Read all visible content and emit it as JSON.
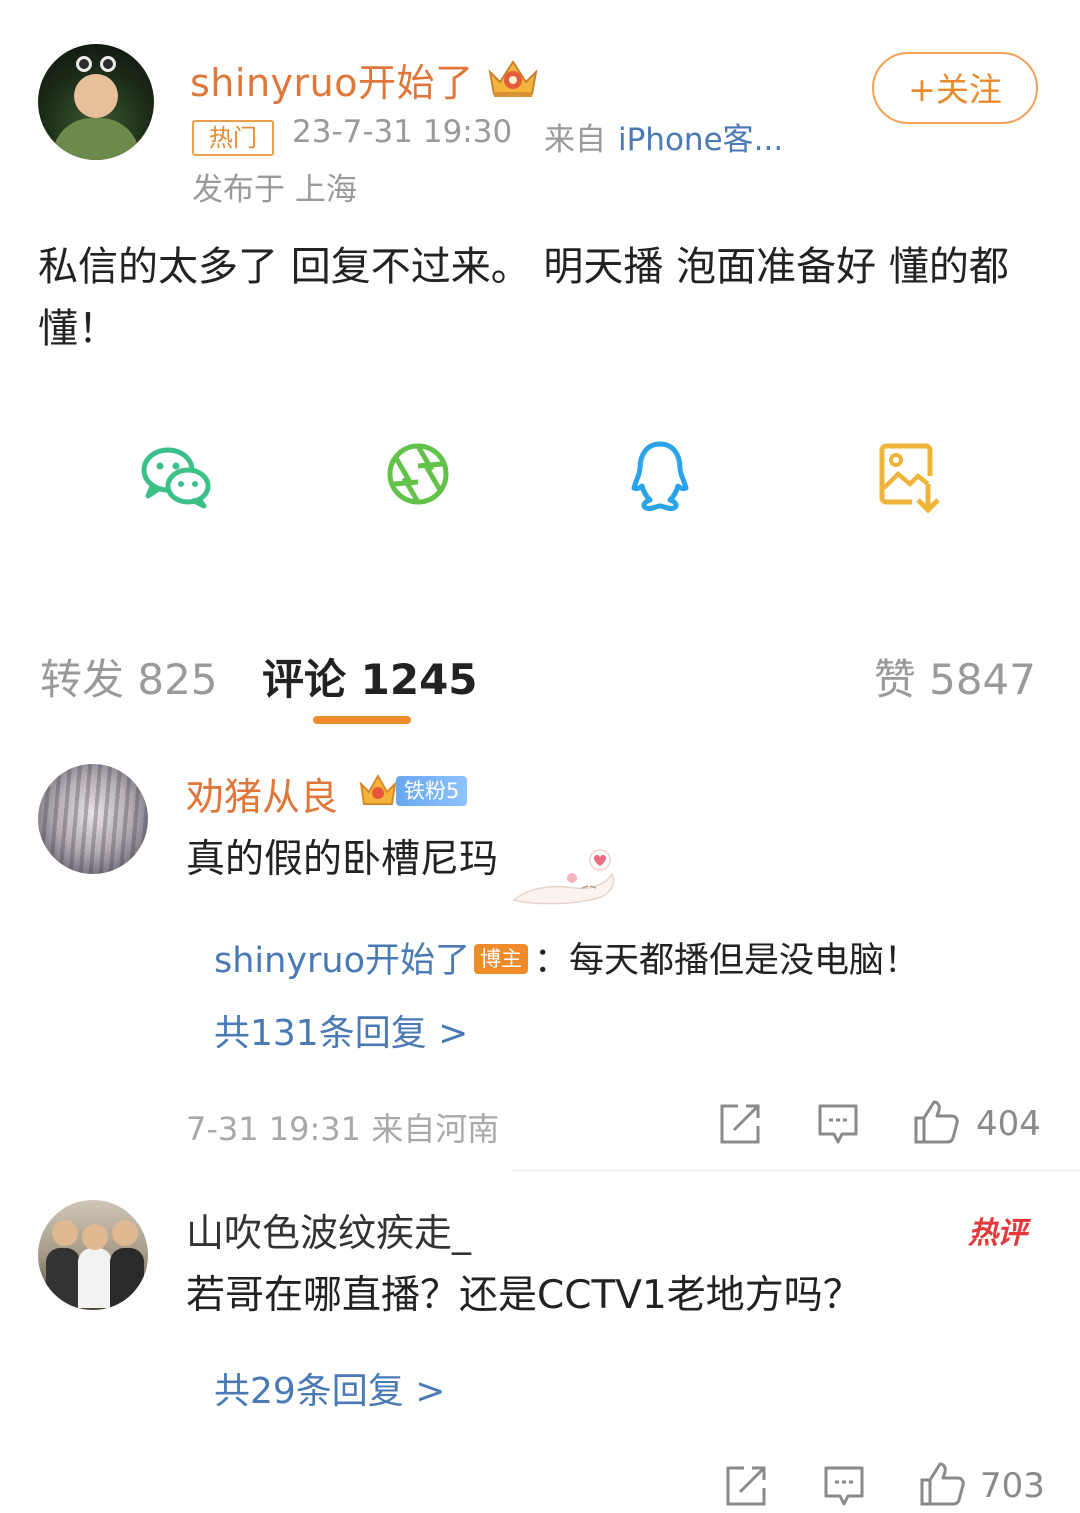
{
  "post": {
    "author": "shinyruo开始了",
    "hot_badge": "热门",
    "time": "23-7-31 19:30",
    "from_label": "来自",
    "client": "iPhone客...",
    "location": "发布于 上海",
    "follow_label": "+关注",
    "text": "私信的太多了 回复不过来。 明天播 泡面准备好 懂的都懂！",
    "share_icons": [
      "wechat-icon",
      "moments-icon",
      "qq-icon",
      "save-image-icon"
    ]
  },
  "stats": {
    "repost": "转发 825",
    "comment": "评论 1245",
    "like": "赞 5847"
  },
  "comments": [
    {
      "author": "劝猪从良",
      "fan_badge": "铁粉5",
      "text": "真的假的卧槽尼玛",
      "reply": {
        "author": "shinyruo开始了",
        "tag": "博主",
        "text": "：每天都播但是没电脑！"
      },
      "reply_count": "共131条回复 >",
      "meta": "7-31 19:31  来自河南",
      "likes": "404"
    },
    {
      "author": "山吹色波纹疾走_",
      "hot_tag": "热评",
      "text": "若哥在哪直播？还是CCTV1老地方吗？",
      "reply_count": "共29条回复 >",
      "likes": "703"
    }
  ],
  "colors": {
    "accent_orange": "#f08b2b",
    "name_orange": "#e0773a",
    "link_blue": "#4a7ab5",
    "hot_red": "#e23a3a"
  }
}
